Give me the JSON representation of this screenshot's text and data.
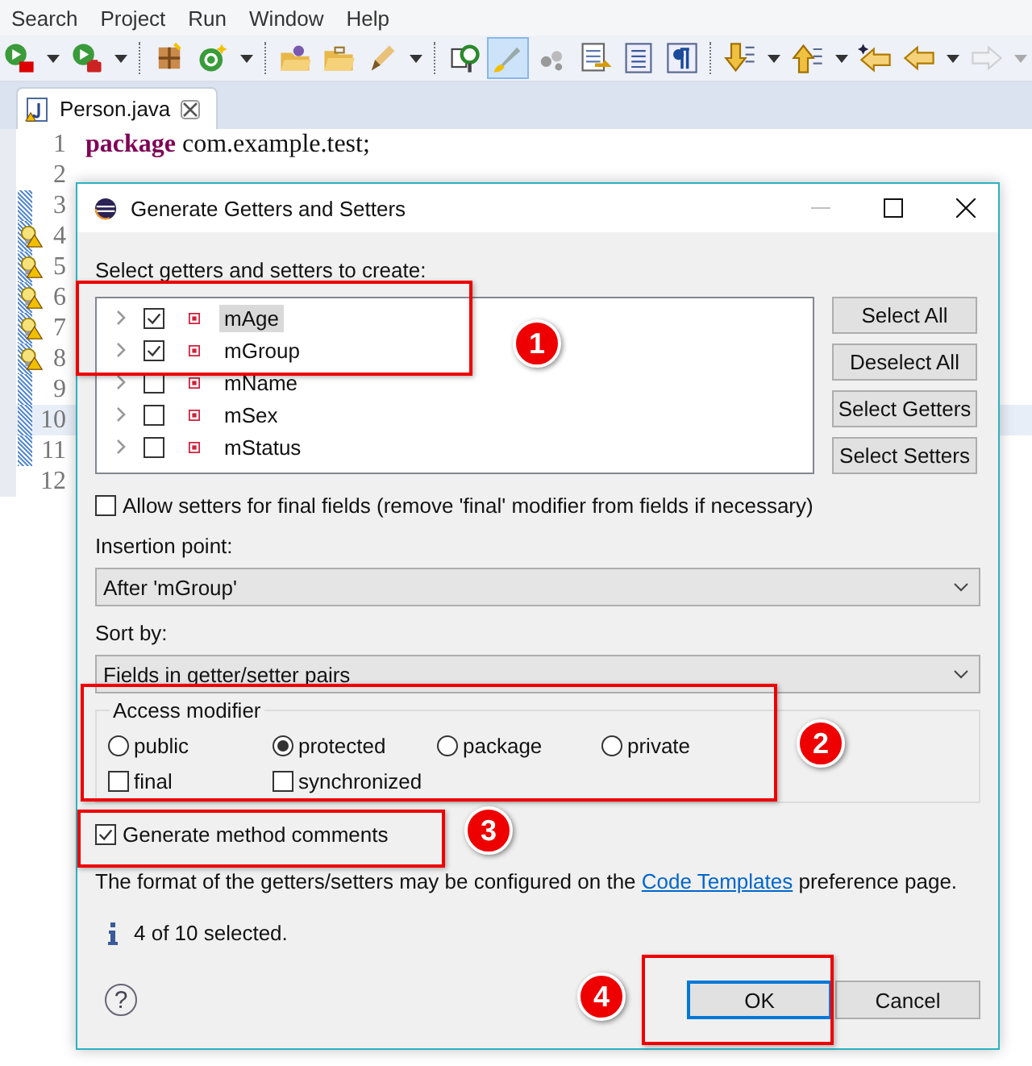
{
  "menu": [
    "Search",
    "Project",
    "Run",
    "Window",
    "Help"
  ],
  "toolbar": [
    {
      "kind": "run",
      "dropdown": true,
      "pressed": false,
      "disabled": false
    },
    {
      "kind": "debug",
      "dropdown": true,
      "pressed": false,
      "disabled": false
    },
    {
      "kind": "separator"
    },
    {
      "kind": "package",
      "dropdown": false,
      "pressed": false,
      "disabled": false
    },
    {
      "kind": "new-class",
      "dropdown": true,
      "pressed": false,
      "disabled": false
    },
    {
      "kind": "separator"
    },
    {
      "kind": "open-folder",
      "dropdown": false,
      "pressed": false,
      "disabled": false
    },
    {
      "kind": "folder",
      "dropdown": false,
      "pressed": false,
      "disabled": false
    },
    {
      "kind": "pen",
      "dropdown": true,
      "pressed": false,
      "disabled": false
    },
    {
      "kind": "separator"
    },
    {
      "kind": "search",
      "dropdown": false,
      "pressed": false,
      "disabled": false
    },
    {
      "kind": "brush",
      "dropdown": false,
      "pressed": true,
      "disabled": false
    },
    {
      "kind": "dots",
      "dropdown": false,
      "pressed": false,
      "disabled": false
    },
    {
      "kind": "document",
      "dropdown": false,
      "pressed": false,
      "disabled": false
    },
    {
      "kind": "list",
      "dropdown": false,
      "pressed": false,
      "disabled": false
    },
    {
      "kind": "pilcrow",
      "dropdown": false,
      "pressed": false,
      "disabled": false
    },
    {
      "kind": "separator"
    },
    {
      "kind": "down",
      "dropdown": true,
      "pressed": false,
      "disabled": false
    },
    {
      "kind": "up",
      "dropdown": true,
      "pressed": false,
      "disabled": false
    },
    {
      "kind": "back-edit",
      "dropdown": false,
      "pressed": false,
      "disabled": false
    },
    {
      "kind": "left",
      "dropdown": true,
      "pressed": false,
      "disabled": false
    },
    {
      "kind": "right",
      "dropdown": true,
      "pressed": false,
      "disabled": true
    }
  ],
  "editor": {
    "tab": "Person.java",
    "lines": [
      {
        "number": "1",
        "keyword": "package",
        "code": "com.example.test;",
        "changed": false,
        "warning": false,
        "current": false
      },
      {
        "number": "2",
        "changed": false,
        "warning": false,
        "current": false
      },
      {
        "number": "3",
        "changed": true,
        "warning": false,
        "current": false
      },
      {
        "number": "4",
        "changed": true,
        "warning": true,
        "current": false
      },
      {
        "number": "5",
        "changed": true,
        "warning": true,
        "current": false
      },
      {
        "number": "6",
        "changed": true,
        "warning": true,
        "current": false
      },
      {
        "number": "7",
        "changed": true,
        "warning": true,
        "current": false
      },
      {
        "number": "8",
        "changed": true,
        "warning": true,
        "current": false
      },
      {
        "number": "9",
        "changed": true,
        "warning": false,
        "current": false
      },
      {
        "number": "10",
        "changed": true,
        "warning": false,
        "current": true
      },
      {
        "number": "11",
        "changed": true,
        "warning": false,
        "current": false
      },
      {
        "number": "12",
        "changed": false,
        "warning": false,
        "current": false
      }
    ]
  },
  "dialog": {
    "title": "Generate Getters and Setters",
    "prompt": "Select getters and setters to create:",
    "fields": [
      {
        "name": "mAge",
        "checked": true,
        "selected": true
      },
      {
        "name": "mGroup",
        "checked": true,
        "selected": false
      },
      {
        "name": "mName",
        "checked": false,
        "selected": false
      },
      {
        "name": "mSex",
        "checked": false,
        "selected": false
      },
      {
        "name": "mStatus",
        "checked": false,
        "selected": false
      }
    ],
    "side_buttons": [
      "Select All",
      "Deselect All",
      "Select Getters",
      "Select Setters"
    ],
    "allow_final": {
      "label": "Allow setters for final fields (remove 'final' modifier from fields if necessary)",
      "checked": false
    },
    "insertion": {
      "label": "Insertion point:",
      "value": "After 'mGroup'"
    },
    "sort": {
      "label": "Sort by:",
      "value": "Fields in getter/setter pairs"
    },
    "access": {
      "title": "Access modifier",
      "modifiers": [
        {
          "label": "public",
          "selected": false
        },
        {
          "label": "protected",
          "selected": true
        },
        {
          "label": "package",
          "selected": false
        },
        {
          "label": "private",
          "selected": false
        }
      ],
      "flags": [
        {
          "label": "final",
          "checked": false
        },
        {
          "label": "synchronized",
          "checked": false
        }
      ]
    },
    "comments": {
      "label": "Generate method comments",
      "checked": true
    },
    "note": {
      "before": "The format of the getters/setters may be configured on the",
      "link": "Code Templates",
      "after": "preference page."
    },
    "status": "4 of 10 selected.",
    "help": "?",
    "buttons": [
      {
        "label": "OK",
        "default": true
      },
      {
        "label": "Cancel",
        "default": false
      }
    ]
  },
  "callouts": [
    "1",
    "2",
    "3",
    "4"
  ]
}
